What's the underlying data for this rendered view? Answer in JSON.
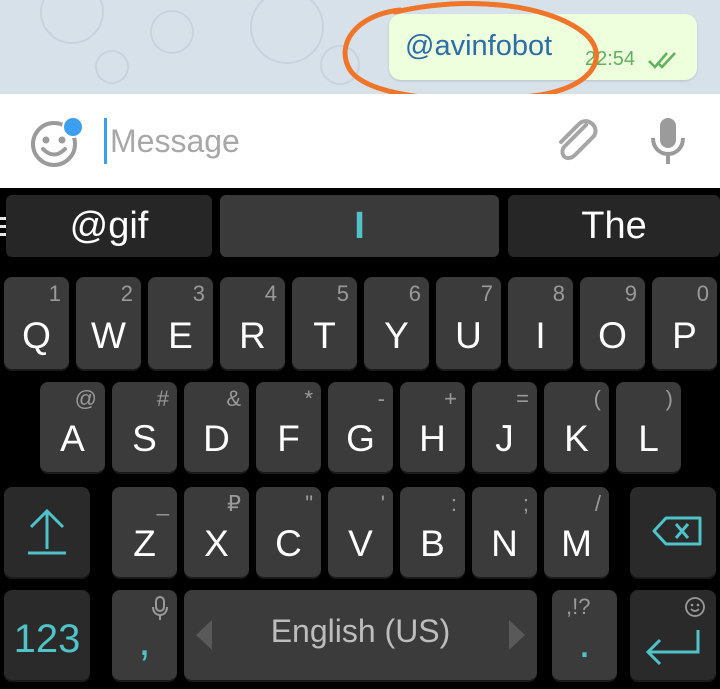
{
  "chat": {
    "message_text": "@avinfobot",
    "message_time": "22:54"
  },
  "input": {
    "placeholder": "Message"
  },
  "keyboard": {
    "suggestions": [
      "@gif",
      "I",
      "The"
    ],
    "row1": [
      {
        "key": "Q",
        "hint": "1"
      },
      {
        "key": "W",
        "hint": "2"
      },
      {
        "key": "E",
        "hint": "3"
      },
      {
        "key": "R",
        "hint": "4"
      },
      {
        "key": "T",
        "hint": "5"
      },
      {
        "key": "Y",
        "hint": "6"
      },
      {
        "key": "U",
        "hint": "7"
      },
      {
        "key": "I",
        "hint": "8"
      },
      {
        "key": "O",
        "hint": "9"
      },
      {
        "key": "P",
        "hint": "0"
      }
    ],
    "row2": [
      {
        "key": "A",
        "hint": "@"
      },
      {
        "key": "S",
        "hint": "#"
      },
      {
        "key": "D",
        "hint": "&"
      },
      {
        "key": "F",
        "hint": "*"
      },
      {
        "key": "G",
        "hint": "-"
      },
      {
        "key": "H",
        "hint": "+"
      },
      {
        "key": "J",
        "hint": "="
      },
      {
        "key": "K",
        "hint": "("
      },
      {
        "key": "L",
        "hint": ")"
      }
    ],
    "row3": [
      {
        "key": "Z",
        "hint": "_"
      },
      {
        "key": "X",
        "hint": "₽"
      },
      {
        "key": "C",
        "hint": "\""
      },
      {
        "key": "V",
        "hint": "'"
      },
      {
        "key": "B",
        "hint": ":"
      },
      {
        "key": "N",
        "hint": ";"
      },
      {
        "key": "M",
        "hint": "/"
      }
    ],
    "numbers_key": "123",
    "comma_key": ",",
    "space_label": "English (US)",
    "period_key": ".",
    "period_hint": ",!?",
    "accent_color": "#4fc3c8"
  }
}
